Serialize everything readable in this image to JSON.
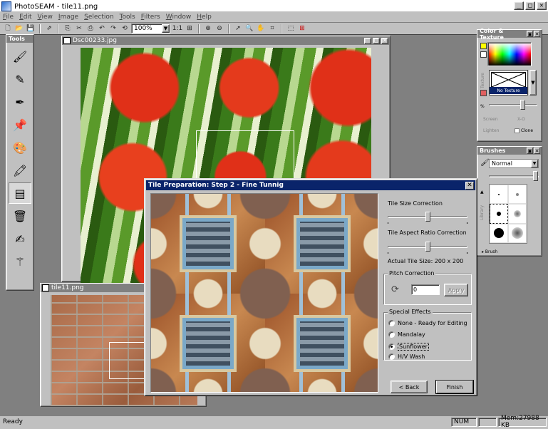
{
  "app": {
    "title": "PhotoSEAM - tile11.png",
    "window_controls": [
      "_",
      "□",
      "✕"
    ]
  },
  "menu": [
    "File",
    "Edit",
    "View",
    "Image",
    "Selection",
    "Tools",
    "Filters",
    "Window",
    "Help"
  ],
  "toolbar": {
    "zoom_value": "100%",
    "ratio_label": "1:1"
  },
  "tools_palette": {
    "title": "Tools",
    "items": [
      "brush-tool",
      "pencil-tool",
      "airbrush-tool",
      "pushpin-tool",
      "palette-tool",
      "paint-tool",
      "paint-roller-tool",
      "bucket-tool",
      "clone-tool",
      "wand-tool"
    ]
  },
  "documents": [
    {
      "title": "Dsc00233.jpg"
    },
    {
      "title": "tile11.png"
    }
  ],
  "dialog": {
    "title": "Tile Preparation: Step 2 - Fine Tunnig",
    "close": "✕",
    "tile_size_label": "Tile Size Correction",
    "tile_size_value": 0.5,
    "aspect_label": "Tile Aspect Ratio Correction",
    "aspect_value": 0.5,
    "actual_size": "Actual Tile Size: 200 x 200",
    "pitch_group": "Pitch Correction",
    "pitch_value": "0",
    "apply_label": "Apply",
    "effects_group": "Special Effects",
    "effects": [
      {
        "label": "None - Ready for Editing",
        "selected": false
      },
      {
        "label": "Mandalay",
        "selected": false
      },
      {
        "label": "Sunflower",
        "selected": true
      },
      {
        "label": "H/V Wash",
        "selected": false
      }
    ],
    "back_label": "< Back",
    "finish_label": "Finish"
  },
  "color_palette": {
    "title": "Color & Texture",
    "texture_side_label": "Texture",
    "texture_name": "No Texture",
    "screen_label": "Screen",
    "xor_label": "X-O",
    "lighten_label": "Lighten",
    "clone_label": "Clone"
  },
  "brushes_palette": {
    "title": "Brushes",
    "mode": "Normal",
    "library_label": "Library",
    "brush_label": "Brush"
  },
  "status": {
    "text": "Ready",
    "num": "NUM",
    "mem": "Mem:27988 KB"
  }
}
